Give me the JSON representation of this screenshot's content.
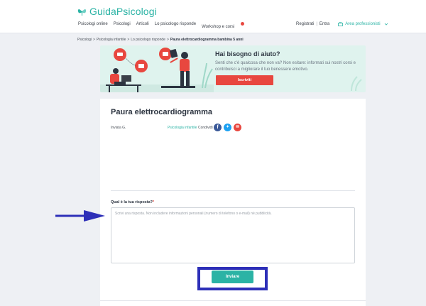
{
  "header": {
    "logo_part1": "Guida",
    "logo_part2": "Psicologi",
    "nav": [
      "Psicologi online",
      "Psicologi",
      "Articoli",
      "Lo psicologo risponde",
      "Workshop e corsi"
    ],
    "register": "Registrati",
    "separator": "|",
    "login": "Entra",
    "pro_area": "Area professionisti"
  },
  "breadcrumb": [
    "Psicologi",
    "Psicologia infantile",
    "Lo psicologo risponde",
    "Paura elettrocardiogramma bambina 5 anni"
  ],
  "banner": {
    "title": "Hai bisogno di aiuto?",
    "text": "Senti che c'è qualcosa che non va? Non esitare: informati sui nostri corsi e contribuisci a migliorare il tuo benessere emotivo.",
    "button": "Iscriviti"
  },
  "question": {
    "title": "Paura elettrocardiogramma",
    "sent_by": "Inviata G.",
    "tag": "Psicologia infantile",
    "share_label": "Condividi"
  },
  "answer": {
    "label": "Qual è la tua risposta?",
    "required_mark": "*",
    "placeholder": "Scrivi una risposta. Non includere informazioni personali (numero di telefono o e-mail) né pubblicità.",
    "submit": "Inviare"
  },
  "colors": {
    "accent": "#2bb3a5",
    "brand_red": "#e8473f",
    "annotation": "#2d2fb8"
  }
}
